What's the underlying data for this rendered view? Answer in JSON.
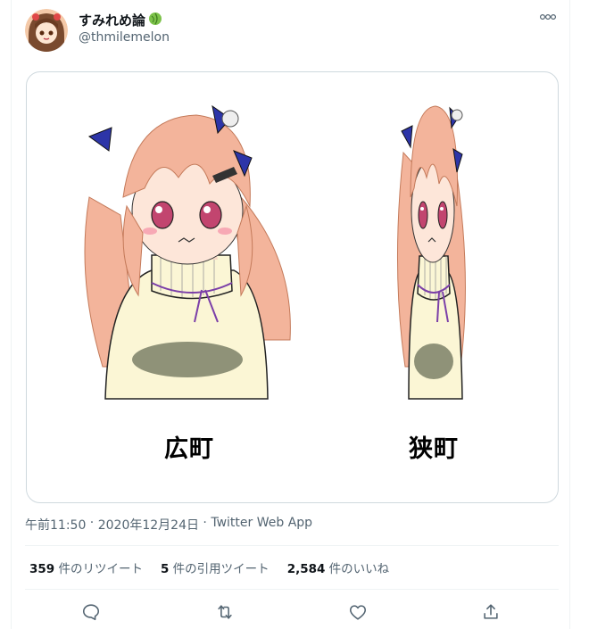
{
  "tweet": {
    "display_name": "すみれめ論",
    "handle": "@thmilemelon",
    "more_label": "ooo",
    "media": {
      "caption_left": "広町",
      "caption_right": "狭町"
    },
    "timestamp": {
      "time": "午前11:50",
      "separator": " · ",
      "date": "2020年12月24日",
      "separator2": " · ",
      "source": "Twitter Web App"
    },
    "stats": {
      "retweets_count": "359",
      "retweets_label": " 件のリツイート",
      "quotes_count": "5",
      "quotes_label": " 件の引用ツイート",
      "likes_count": "2,584",
      "likes_label": " 件のいいね"
    },
    "actions": {
      "reply_icon": "reply-icon",
      "retweet_icon": "retweet-icon",
      "like_icon": "heart-icon",
      "share_icon": "share-icon"
    },
    "colors": {
      "text_primary": "#0f1419",
      "text_secondary": "#536471",
      "border": "#cfd9de",
      "hair_pink": "#f3b49b",
      "ribbon_blue": "#2d35a8",
      "sweater": "#fbf6d5",
      "badge_green": "#67b33c"
    }
  }
}
